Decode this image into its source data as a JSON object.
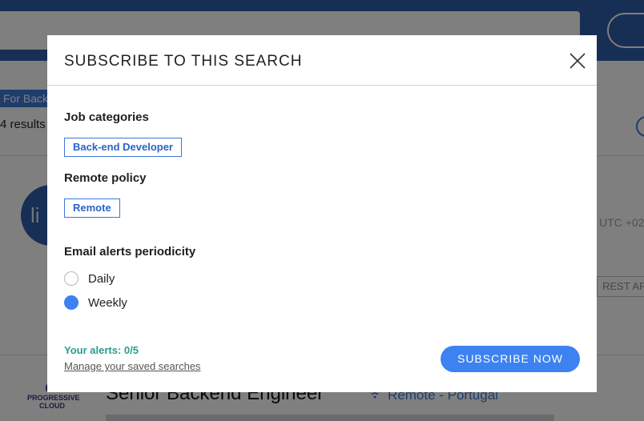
{
  "background": {
    "chip_text": "For Backend",
    "results_text": "4 results",
    "avatar_text": "li",
    "timezone_text": "UTC +02",
    "rest_button": "REST API",
    "logo_text": "PROGRESSIVE CLOUD",
    "job_title": "Senior Backend Engineer",
    "job_location": "Remote - Portugal"
  },
  "modal": {
    "title": "SUBSCRIBE TO THIS SEARCH",
    "job_categories_label": "Job categories",
    "job_category_tag": "Back-end Developer",
    "remote_policy_label": "Remote policy",
    "remote_policy_tag": "Remote",
    "periodicity_label": "Email alerts periodicity",
    "options": [
      {
        "label": "Daily",
        "checked": false
      },
      {
        "label": "Weekly",
        "checked": true
      }
    ],
    "alerts_count": "Your alerts: 0/5",
    "manage_link": "Manage your saved searches",
    "subscribe_button": "SUBSCRIBE NOW"
  },
  "colors": {
    "accent": "#3c82f0",
    "topbar": "#2f5fa8",
    "alerts_text": "#2a9d8f"
  },
  "icons": {
    "close": "close-icon",
    "location": "wifi-icon"
  }
}
